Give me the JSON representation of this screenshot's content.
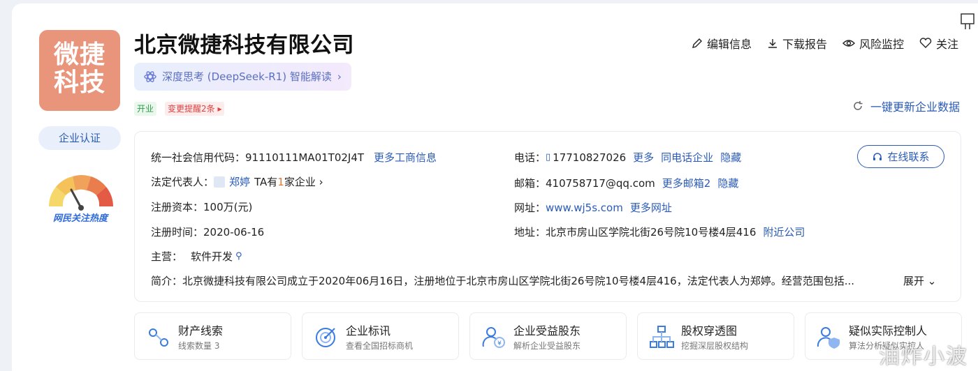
{
  "company": {
    "logo_text_line1": "微捷",
    "logo_text_line2": "科技",
    "name": "北京微捷科技有限公司",
    "verify_label": "企业认证",
    "heat_label": "网民关注热度",
    "ai_button": "深度思考 (DeepSeek-R1) 智能解读",
    "status_badge": "开业",
    "change_badge": "变更提醒2条"
  },
  "actions": {
    "edit": "编辑信息",
    "download": "下载报告",
    "monitor": "风险监控",
    "follow": "关注",
    "refresh": "一键更新企业数据"
  },
  "info": {
    "credit_label": "统一社会信用代码：",
    "credit_value": "91110111MA01T02J4T",
    "credit_more": "更多工商信息",
    "legal_label": "法定代表人：",
    "legal_name": "郑婷",
    "legal_ta_prefix": "TA有",
    "legal_count": "1",
    "legal_ta_suffix": "家企业",
    "capital_label": "注册资本：",
    "capital_value": "100万(元)",
    "date_label": "注册时间：",
    "date_value": "2020-06-16",
    "main_label": "主营：",
    "main_value": "软件开发",
    "phone_label": "电话：",
    "phone_value": "17710827026",
    "phone_more": "更多",
    "phone_same": "同电话企业",
    "phone_hide": "隐藏",
    "email_label": "邮箱：",
    "email_value": "410758717@qq.com",
    "email_more": "更多邮箱2",
    "email_hide": "隐藏",
    "site_label": "网址：",
    "site_value": "www.wj5s.com",
    "site_more": "更多网址",
    "addr_label": "地址：",
    "addr_value": "北京市房山区学院北街26号院10号楼4层416",
    "addr_near": "附近公司",
    "intro_label": "简介：",
    "intro_value": "北京微捷科技有限公司成立于2020年06月16日，注册地位于北京市房山区学院北街26号院10号楼4层416，法定代表人为郑婷。经营范围包括...",
    "intro_expand": "展开",
    "online_contact": "在线联系"
  },
  "tiles": [
    {
      "title": "财产线索",
      "sub": "线索数量 3",
      "icon": "property-clue-icon"
    },
    {
      "title": "企业标讯",
      "sub": "查看全国招标商机",
      "icon": "bidding-target-icon"
    },
    {
      "title": "企业受益股东",
      "sub": "解析企业受益股东",
      "icon": "beneficiary-icon"
    },
    {
      "title": "股权穿透图",
      "sub": "挖掘深层股权结构",
      "icon": "equity-chart-icon"
    },
    {
      "title": "疑似实际控制人",
      "sub": "算法分析疑似实控人",
      "icon": "controller-shield-icon"
    }
  ],
  "watermark": "油炸小波",
  "colors": {
    "link": "#2a5bb8",
    "logo_bg": "#e8957c",
    "open_green": "#2e9e4a",
    "change_red": "#e04242"
  }
}
